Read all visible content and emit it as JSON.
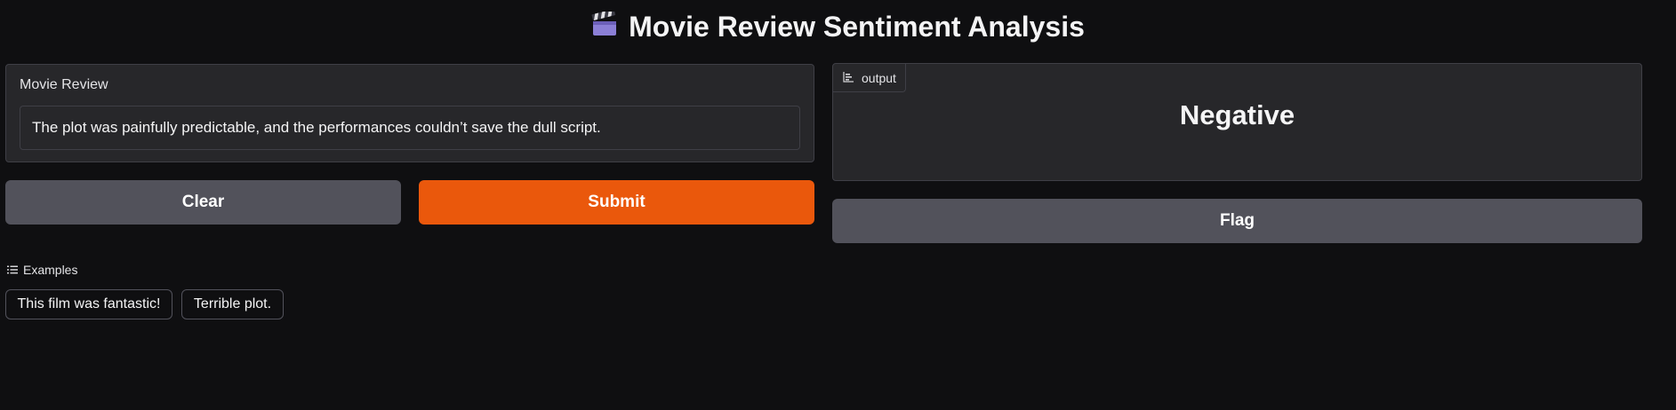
{
  "header": {
    "title": "Movie Review Sentiment Analysis",
    "icon": "clapper-board-icon"
  },
  "input": {
    "label": "Movie Review",
    "value": "The plot was painfully predictable, and the performances couldn’t save the dull script."
  },
  "actions": {
    "clear_label": "Clear",
    "submit_label": "Submit",
    "flag_label": "Flag"
  },
  "output": {
    "label": "output",
    "icon": "bar-chart-icon",
    "value": "Negative"
  },
  "examples": {
    "label": "Examples",
    "icon": "list-icon",
    "items": [
      "This film was fantastic!",
      "Terrible plot."
    ]
  },
  "colors": {
    "background": "#0f0f11",
    "panel": "#27272a",
    "border": "#3f3f46",
    "secondary_button": "#52525b",
    "primary_button": "#ea580c"
  }
}
